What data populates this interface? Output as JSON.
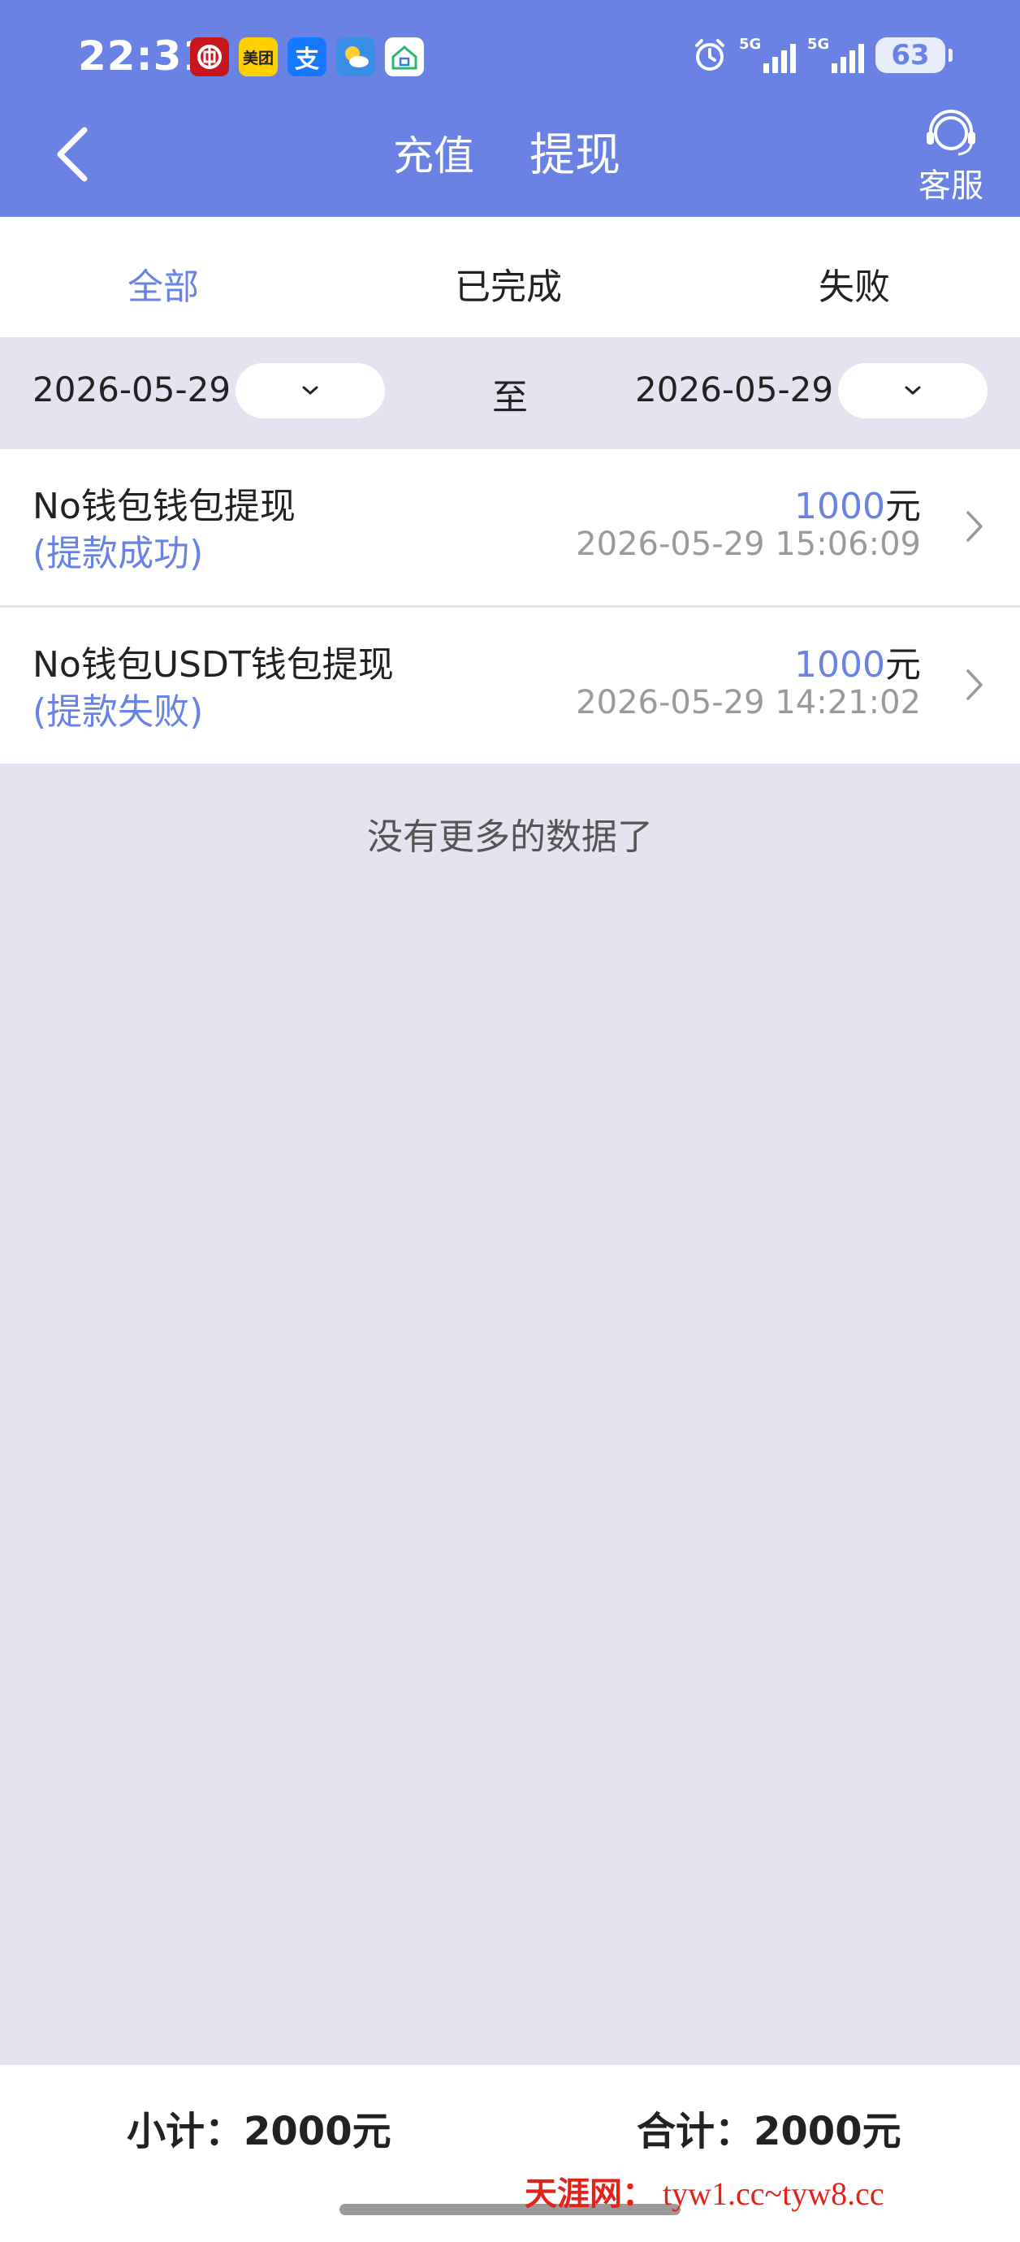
{
  "status_bar": {
    "time": "22:31",
    "app_icons": [
      "bank-of-china-icon",
      "meituan-icon",
      "alipay-icon",
      "weather-icon",
      "home-app-icon"
    ],
    "meituan_label": "美团",
    "alipay_label": "支",
    "network_1": "5G",
    "network_2": "5G",
    "battery": "63"
  },
  "header": {
    "tab_recharge": "充值",
    "tab_withdraw": "提现",
    "service_label": "客服",
    "color": "#6a82e3"
  },
  "filter_tabs": [
    "全部",
    "已完成",
    "失败"
  ],
  "filter_tab_active": "全部",
  "date_filter": {
    "from": "2026-05-29",
    "separator": "至",
    "to": "2026-05-29"
  },
  "records": [
    {
      "title": "No钱包钱包提现",
      "status": "(提款成功)",
      "amount": "1000",
      "unit": "元",
      "time": "2026-05-29 15:06:09"
    },
    {
      "title": "No钱包USDT钱包提现",
      "status": "(提款失败)",
      "amount": "1000",
      "unit": "元",
      "time": "2026-05-29 14:21:02"
    }
  ],
  "no_more_text": "没有更多的数据了",
  "footer": {
    "subtotal": "小计：2000元",
    "total": "合计：2000元"
  },
  "watermark": {
    "site": "天涯网：",
    "urls": "tyw1.cc~tyw8.cc"
  }
}
